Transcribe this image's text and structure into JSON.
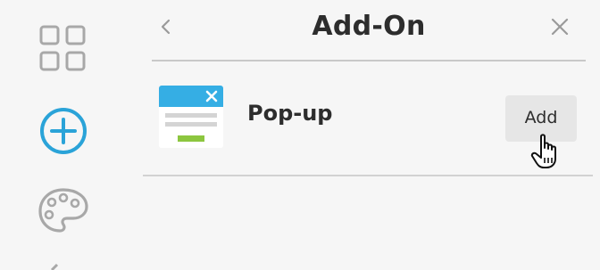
{
  "sidebar": {
    "items": [
      {
        "icon": "apps-grid-icon"
      },
      {
        "icon": "add-circle-icon",
        "active": true
      },
      {
        "icon": "palette-icon"
      }
    ]
  },
  "panel": {
    "title": "Add-On",
    "back_icon": "chevron-left-icon",
    "close_icon": "close-icon"
  },
  "addons": [
    {
      "name": "Pop-up",
      "icon": "popup-window-icon",
      "button_label": "Add"
    }
  ],
  "colors": {
    "accent": "#2aa3d8",
    "icon_gray": "#a8a8a8",
    "popup_header": "#35aee4",
    "popup_button": "#8cc63f",
    "text": "#2d2d2d"
  }
}
